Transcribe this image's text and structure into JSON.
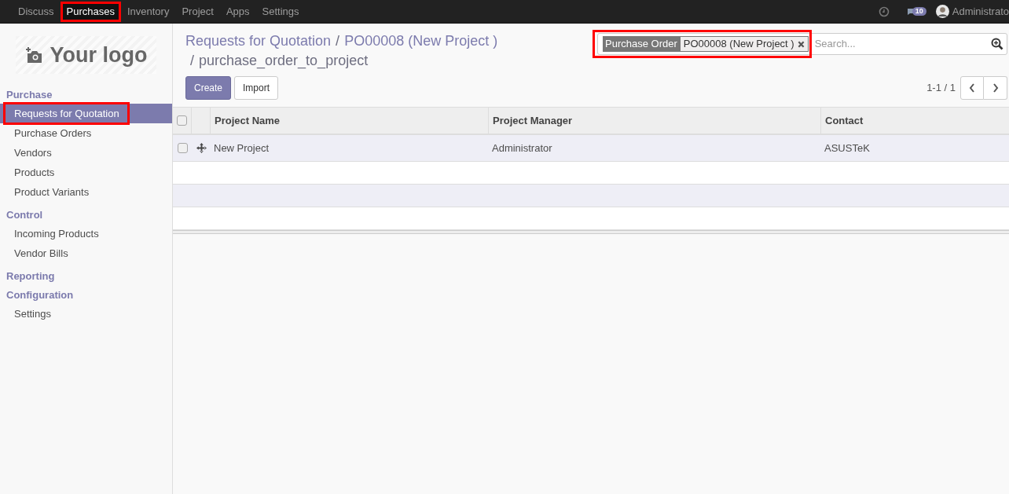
{
  "topbar": {
    "menu": [
      {
        "label": "Discuss",
        "selected": false,
        "highlighted": false
      },
      {
        "label": "Purchases",
        "selected": true,
        "highlighted": true
      },
      {
        "label": "Inventory",
        "selected": false,
        "highlighted": false
      },
      {
        "label": "Project",
        "selected": false,
        "highlighted": false
      },
      {
        "label": "Apps",
        "selected": false,
        "highlighted": false
      },
      {
        "label": "Settings",
        "selected": false,
        "highlighted": false
      }
    ],
    "messages": {
      "count": "10"
    },
    "user": {
      "name": "Administrato"
    }
  },
  "sidebar": {
    "logo": {
      "text": "Your logo"
    },
    "sections": [
      {
        "title": "Purchase",
        "items": [
          {
            "label": "Requests for Quotation",
            "selected": true,
            "highlighted": true
          },
          {
            "label": "Purchase Orders",
            "selected": false,
            "highlighted": false
          },
          {
            "label": "Vendors",
            "selected": false,
            "highlighted": false
          },
          {
            "label": "Products",
            "selected": false,
            "highlighted": false
          },
          {
            "label": "Product Variants",
            "selected": false,
            "highlighted": false
          }
        ]
      },
      {
        "title": "Control",
        "items": [
          {
            "label": "Incoming Products",
            "selected": false,
            "highlighted": false
          },
          {
            "label": "Vendor Bills",
            "selected": false,
            "highlighted": false
          }
        ]
      },
      {
        "title": "Reporting"
      },
      {
        "title": "Configuration",
        "items": [
          {
            "label": "Settings",
            "selected": false,
            "highlighted": false
          }
        ]
      }
    ]
  },
  "breadcrumb": [
    {
      "kind": "link",
      "text": "Requests for Quotation"
    },
    {
      "kind": "separator",
      "text": "/"
    },
    {
      "kind": "link",
      "text": "PO00008 (New Project )"
    },
    {
      "kind": "separator",
      "text": "/"
    },
    {
      "kind": "current",
      "text": "purchase_order_to_project"
    }
  ],
  "buttons": [
    {
      "label": "Create",
      "kind": "primary"
    },
    {
      "label": "Import",
      "kind": "secondary"
    }
  ],
  "search": {
    "facet": {
      "field": "Purchase Order",
      "value": "PO00008 (New Project )"
    },
    "placeholder": "Search...",
    "highlighted": true
  },
  "pager": {
    "text": "1-1 / 1"
  },
  "table": {
    "columns": [
      "Project Name",
      "Project Manager",
      "Contact"
    ],
    "all_checked": false,
    "rows": [
      {
        "cells": [
          "New Project",
          "Administrator",
          "ASUSTeK"
        ],
        "checked": false
      }
    ]
  }
}
